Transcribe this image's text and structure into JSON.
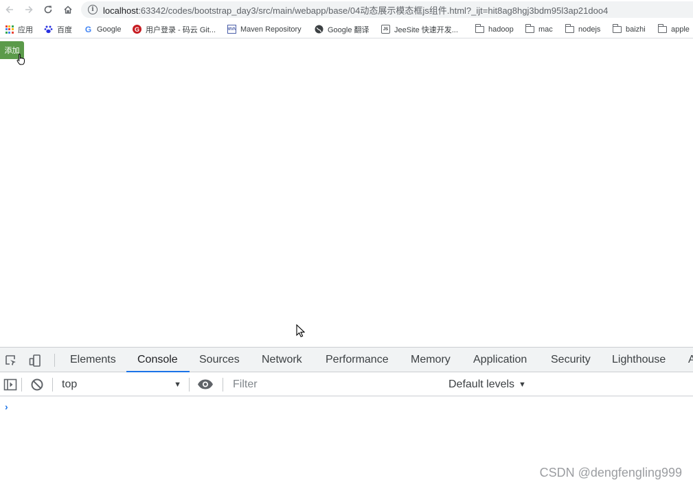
{
  "browser": {
    "url_host": "localhost",
    "url_rest": ":63342/codes/bootstrap_day3/src/main/webapp/base/04动态展示模态框js组件.html?_ijt=hit8ag8hgj3bdm95l3ap21doo4"
  },
  "bookmarks": [
    {
      "label": "应用",
      "icon": "apps-grid-icon"
    },
    {
      "label": "百度",
      "icon": "baidu-paw-icon"
    },
    {
      "label": "Google",
      "icon": "google-g-icon"
    },
    {
      "label": "用户登录 - 码云 Git...",
      "icon": "gitee-icon"
    },
    {
      "label": "Maven Repository",
      "icon": "mvn-icon"
    },
    {
      "label": "Google 翻译",
      "icon": "globe-icon"
    },
    {
      "label": "JeeSite 快速开发...",
      "icon": "js-icon"
    },
    {
      "label": "hadoop",
      "icon": "folder-icon"
    },
    {
      "label": "mac",
      "icon": "folder-icon"
    },
    {
      "label": "nodejs",
      "icon": "folder-icon"
    },
    {
      "label": "baizhi",
      "icon": "folder-icon"
    },
    {
      "label": "apple",
      "icon": "folder-icon"
    }
  ],
  "page": {
    "add_button_label": "添加",
    "add_button_color": "#5b9a4a"
  },
  "devtools": {
    "tabs": [
      "Elements",
      "Console",
      "Sources",
      "Network",
      "Performance",
      "Memory",
      "Application",
      "Security",
      "Lighthouse",
      "A"
    ],
    "active_tab": "Console",
    "context": "top",
    "filter_placeholder": "Filter",
    "levels_label": "Default levels",
    "prompt": "›",
    "accent_color": "#1a73e8"
  },
  "watermark": "CSDN @dengfengling999"
}
